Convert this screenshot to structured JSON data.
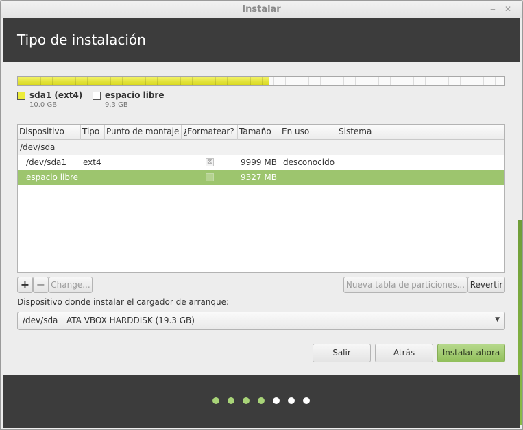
{
  "window": {
    "title": "Instalar",
    "minimize_glyph": "‒",
    "close_glyph": "✕"
  },
  "header": {
    "title": "Tipo de instalación"
  },
  "partition_bar": {
    "used_fraction": 0.515,
    "used_color": "#e0e02a"
  },
  "legend": [
    {
      "name": "sda1 (ext4)",
      "size": "10.0 GB",
      "color": "#ecec3a"
    },
    {
      "name": "espacio libre",
      "size": "9.3 GB",
      "color": "#ffffff"
    }
  ],
  "table": {
    "columns": [
      "Dispositivo",
      "Tipo",
      "Punto de montaje",
      "¿Formatear?",
      "Tamaño",
      "En uso",
      "Sistema"
    ],
    "rows": [
      {
        "device": "/dev/sda",
        "type": "",
        "mount": "",
        "format": "",
        "size": "",
        "used": "",
        "system": ""
      },
      {
        "device": "/dev/sda1",
        "type": "ext4",
        "mount": "",
        "format": "☒",
        "size": "9999 MB",
        "used": "desconocido",
        "system": ""
      },
      {
        "device": "espacio libre",
        "type": "",
        "mount": "",
        "format": "",
        "size": "9327 MB",
        "used": "",
        "system": "",
        "selected": true
      }
    ]
  },
  "toolbar": {
    "add_label": "+",
    "remove_label": "−",
    "change_label": "Change...",
    "new_table_label": "Nueva tabla de particiones...",
    "revert_label": "Revertir"
  },
  "bootloader": {
    "label": "Dispositivo donde instalar el cargador de arranque:",
    "device": "/dev/sda",
    "disk": "ATA VBOX HARDDISK (19.3 GB)",
    "arrow": "▼"
  },
  "actions": {
    "quit_label": "Salir",
    "back_label": "Atrás",
    "install_label": "Instalar ahora"
  },
  "progress": {
    "total_steps": 7,
    "completed_steps": 4,
    "active_color": "#a8d478",
    "inactive_color": "#ffffff"
  }
}
